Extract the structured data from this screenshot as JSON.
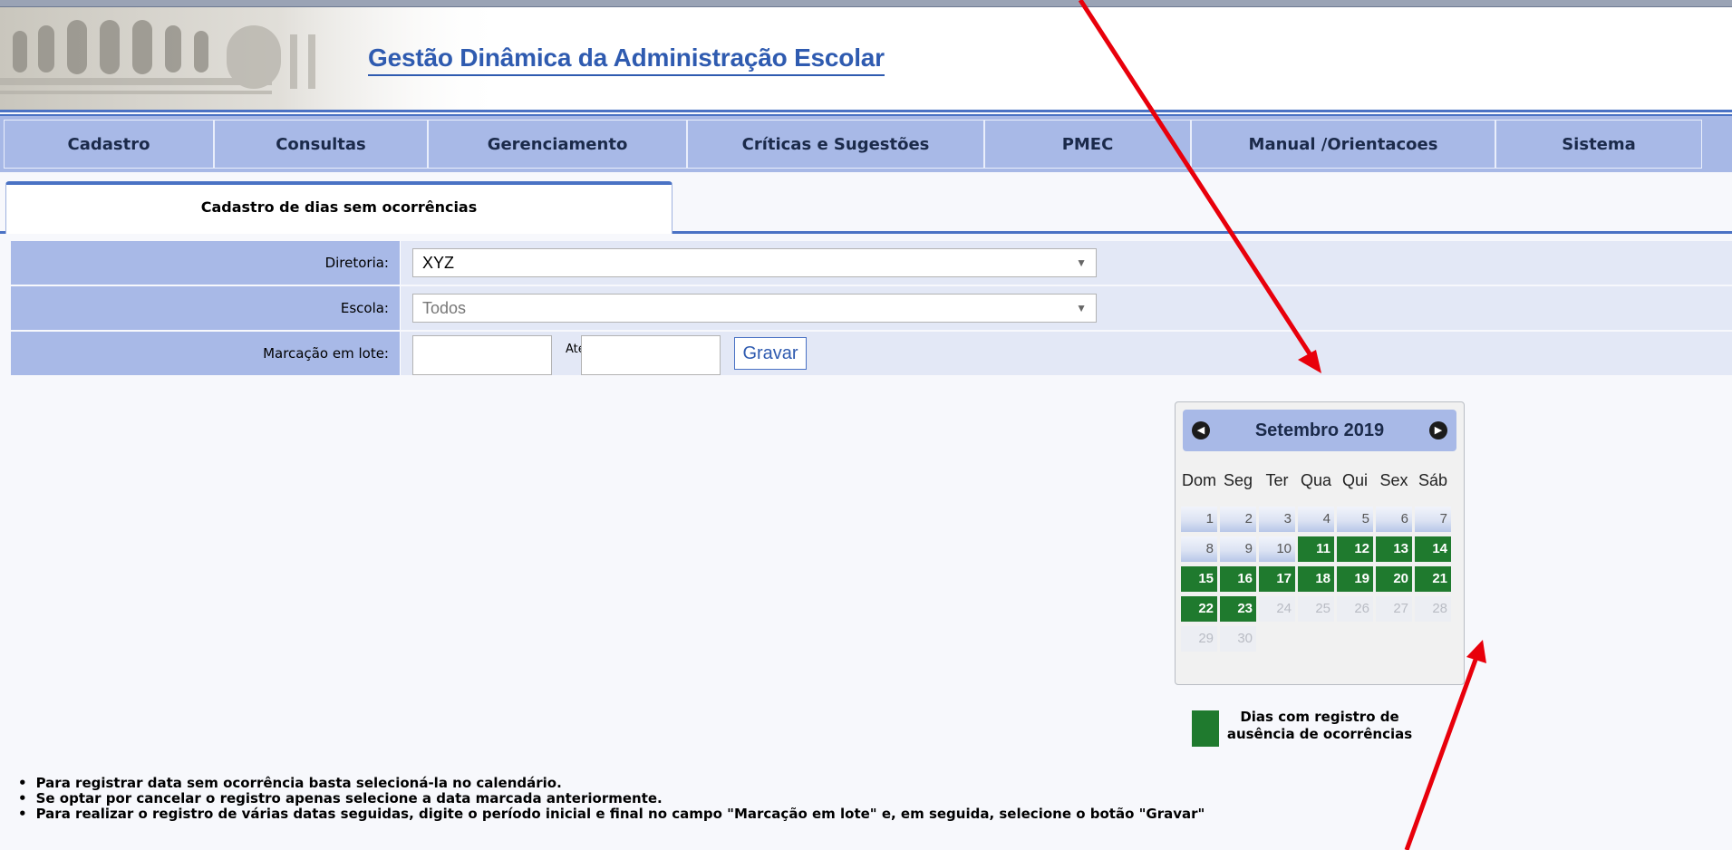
{
  "app": {
    "title": "Gestão Dinâmica da Administração Escolar"
  },
  "nav": {
    "items": [
      {
        "label": "Cadastro"
      },
      {
        "label": "Consultas"
      },
      {
        "label": "Gerenciamento"
      },
      {
        "label": "Críticas e Sugestões"
      },
      {
        "label": "PMEC"
      },
      {
        "label": "Manual /Orientacoes"
      },
      {
        "label": "Sistema"
      }
    ]
  },
  "tab": {
    "label": "Cadastro de dias sem ocorrências"
  },
  "form": {
    "diretoria": {
      "label": "Diretoria:",
      "value": "XYZ"
    },
    "escola": {
      "label": "Escola:",
      "value": "Todos"
    },
    "lote": {
      "label": "Marcação em lote:",
      "ate_label": "Até",
      "from_value": "",
      "to_value": "",
      "button_label": "Gravar"
    }
  },
  "calendar": {
    "month_label": "Setembro 2019",
    "weekdays": [
      "Dom",
      "Seg",
      "Ter",
      "Qua",
      "Qui",
      "Sex",
      "Sáb"
    ],
    "weeks": [
      [
        "1",
        "2",
        "3",
        "4",
        "5",
        "6",
        "7"
      ],
      [
        "8",
        "9",
        "10",
        "11",
        "12",
        "13",
        "14"
      ],
      [
        "15",
        "16",
        "17",
        "18",
        "19",
        "20",
        "21"
      ],
      [
        "22",
        "23",
        "24",
        "25",
        "26",
        "27",
        "28"
      ],
      [
        "29",
        "30",
        "",
        "",
        "",
        "",
        ""
      ]
    ],
    "marked_days": [
      11,
      12,
      13,
      14,
      15,
      16,
      17,
      18,
      19,
      20,
      21,
      22,
      23
    ],
    "disabled_from": 24,
    "marked_color": "#1f7a2e"
  },
  "legend": {
    "text": "Dias com registro de ausência de ocorrências",
    "color": "#1f7a2e"
  },
  "instructions": [
    "Para registrar data sem ocorrência basta selecioná-la no calendário.",
    "Se optar por cancelar o registro apenas selecione a data marcada anteriormente.",
    "Para realizar o registro de várias datas seguidas, digite o período inicial e final no campo \"Marcação em lote\" e, em seguida, selecione o botão \"Gravar\""
  ],
  "colors": {
    "accent": "#4a72c4",
    "nav_bg": "#a8b9e7",
    "arrow": "#e8000b"
  }
}
